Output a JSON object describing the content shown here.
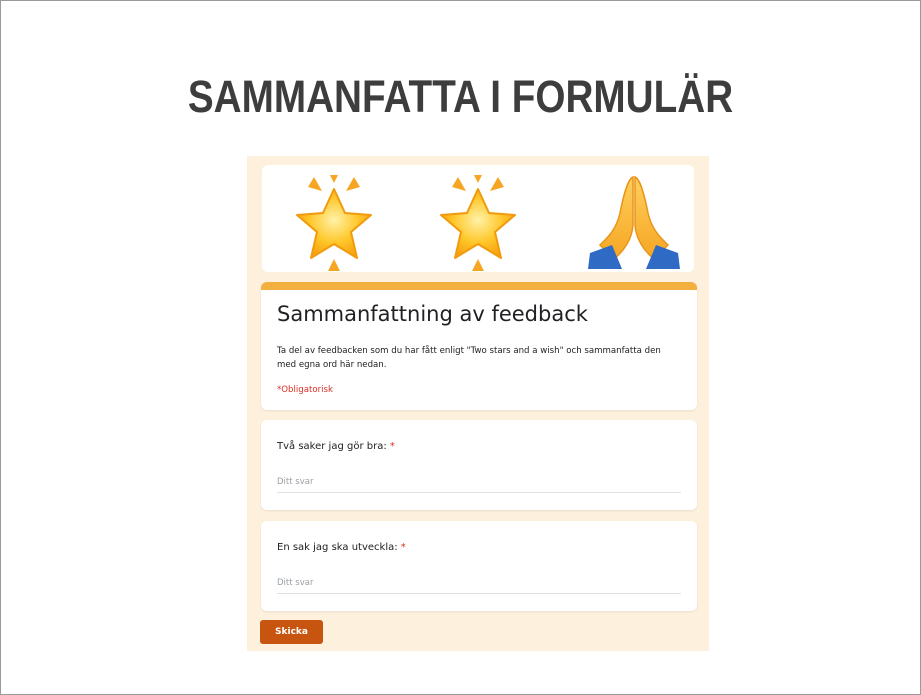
{
  "slide": {
    "title": "SAMMANFATTA I FORMULÄR"
  },
  "banner": {
    "icons": [
      "sparkle-star-icon",
      "sparkle-star-icon",
      "praying-hands-icon"
    ]
  },
  "form": {
    "title": "Sammanfattning av feedback",
    "description": "Ta del av feedbacken som du har fått enligt \"Two stars and a wish\" och sammanfatta den med egna ord här nedan.",
    "required_note": "*Obligatorisk",
    "questions": [
      {
        "label": "Två saker jag gör bra:",
        "required_marker": "*",
        "placeholder": "Ditt svar"
      },
      {
        "label": "En sak jag ska utveckla:",
        "required_marker": "*",
        "placeholder": "Ditt svar"
      }
    ],
    "submit_label": "Skicka"
  },
  "colors": {
    "title_text": "#3d3d3d",
    "form_background": "#fdf1dd",
    "header_accent": "#f4b03e",
    "required_red": "#d93025",
    "submit_button": "#c8550f"
  }
}
